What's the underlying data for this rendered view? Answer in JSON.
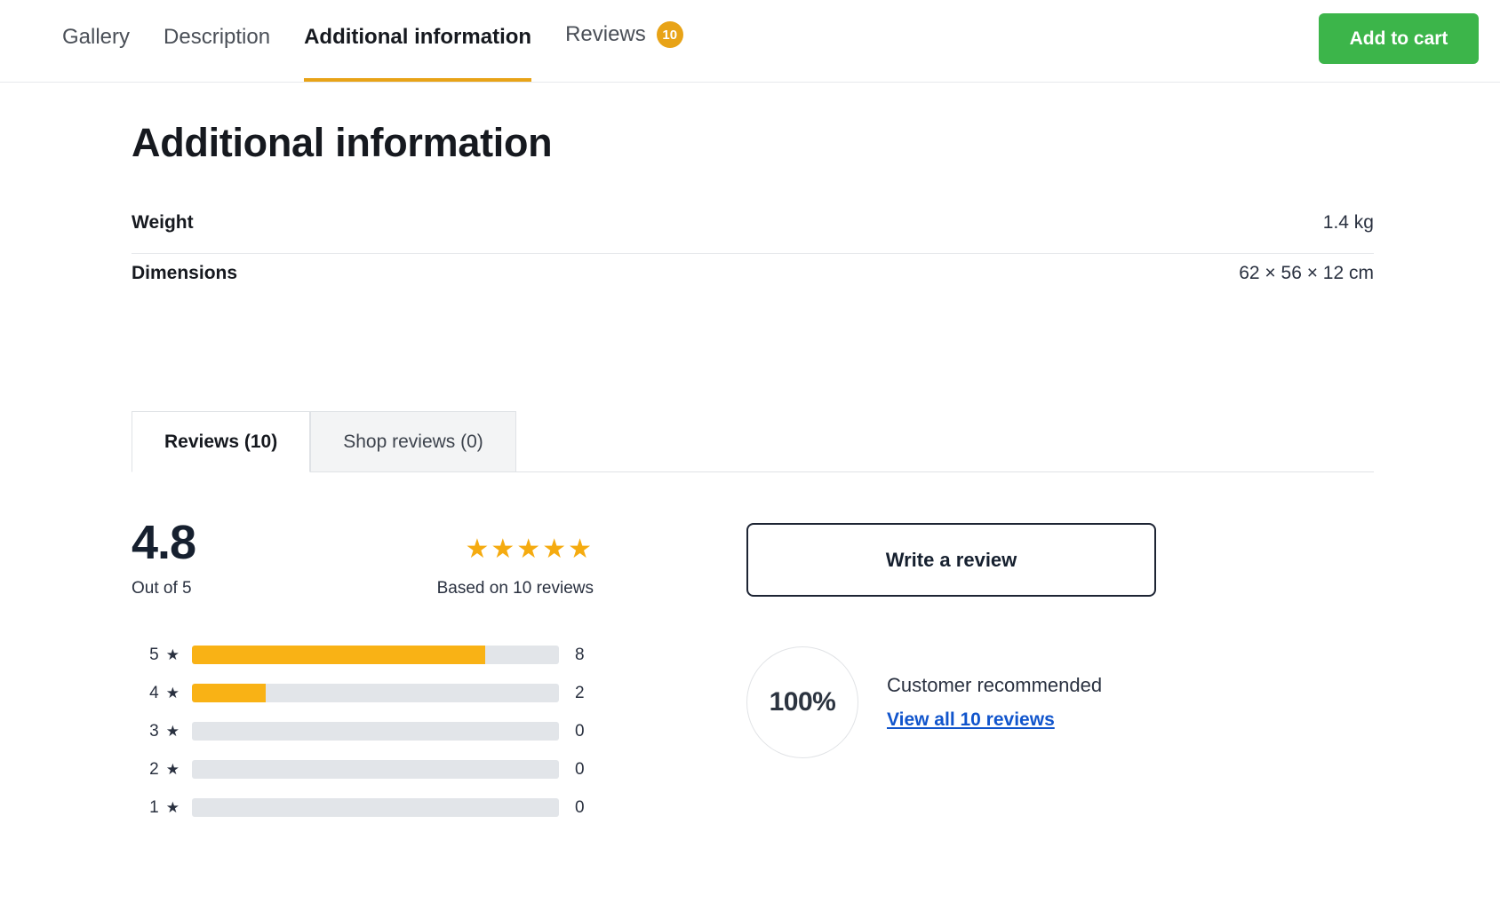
{
  "nav": {
    "tabs": [
      {
        "label": "Gallery",
        "active": false
      },
      {
        "label": "Description",
        "active": false
      },
      {
        "label": "Additional information",
        "active": true
      },
      {
        "label": "Reviews",
        "active": false,
        "badge": "10"
      }
    ],
    "add_to_cart_label": "Add to cart",
    "accent_color": "#e8a317",
    "cart_button_color": "#3cb54a"
  },
  "page": {
    "title": "Additional information"
  },
  "attributes": {
    "rows": [
      {
        "label": "Weight",
        "value": "1.4 kg"
      },
      {
        "label": "Dimensions",
        "value": "62 × 56 × 12 cm"
      }
    ]
  },
  "reviews": {
    "tabs": [
      {
        "label": "Reviews (10)",
        "active": true
      },
      {
        "label": "Shop reviews (0)",
        "active": false
      }
    ],
    "score": "4.8",
    "score_caption": "Out of 5",
    "stars_display": "★★★★★",
    "stars_filled": 5,
    "based_on": "Based on 10 reviews",
    "star_color": "#f5ab10",
    "breakdown": [
      {
        "stars": "5",
        "star_glyph": "★",
        "count": "8",
        "percent": 80
      },
      {
        "stars": "4",
        "star_glyph": "★",
        "count": "2",
        "percent": 20
      },
      {
        "stars": "3",
        "star_glyph": "★",
        "count": "0",
        "percent": 0
      },
      {
        "stars": "2",
        "star_glyph": "★",
        "count": "0",
        "percent": 0
      },
      {
        "stars": "1",
        "star_glyph": "★",
        "count": "0",
        "percent": 0
      }
    ],
    "write_review_label": "Write a review",
    "recommend_percent": "100%",
    "recommend_title": "Customer recommended",
    "view_all_label": "View all 10 reviews",
    "link_color": "#1155cc"
  }
}
